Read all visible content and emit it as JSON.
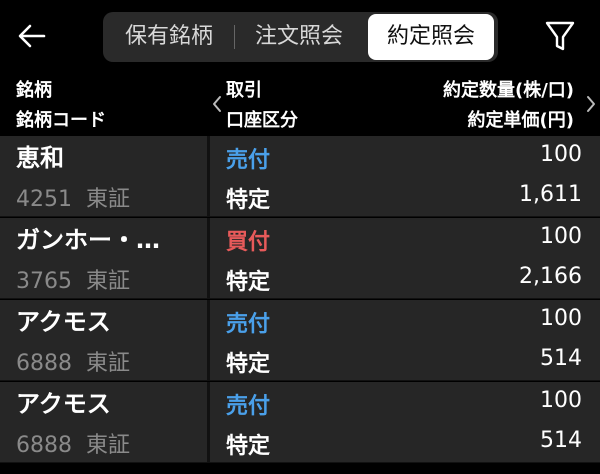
{
  "topbar": {
    "tabs": [
      "保有銘柄",
      "注文照会",
      "約定照会"
    ],
    "active_tab": 2
  },
  "header": {
    "col1_line1": "銘柄",
    "col1_line2": "銘柄コード",
    "col2_line1": "取引",
    "col2_line2": "口座区分",
    "col3_line1": "約定数量(株/口)",
    "col3_line2": "約定単価(円)"
  },
  "rows": [
    {
      "name": "恵和",
      "code": "4251",
      "market": "東証",
      "trade": "売付",
      "trade_type": "sell",
      "account": "特定",
      "qty": "100",
      "price": "1,611"
    },
    {
      "name": "ガンホー・…",
      "code": "3765",
      "market": "東証",
      "trade": "買付",
      "trade_type": "buy",
      "account": "特定",
      "qty": "100",
      "price": "2,166"
    },
    {
      "name": "アクモス",
      "code": "6888",
      "market": "東証",
      "trade": "売付",
      "trade_type": "sell",
      "account": "特定",
      "qty": "100",
      "price": "514"
    },
    {
      "name": "アクモス",
      "code": "6888",
      "market": "東証",
      "trade": "売付",
      "trade_type": "sell",
      "account": "特定",
      "qty": "100",
      "price": "514"
    }
  ],
  "colors": {
    "sell": "#4aa0ea",
    "buy": "#e85a5a",
    "row_bg": "#262626"
  },
  "icons": {
    "back": "back-arrow-icon",
    "filter": "filter-funnel-icon",
    "scroll_left": "chevron-left-icon",
    "scroll_right": "chevron-right-icon"
  }
}
